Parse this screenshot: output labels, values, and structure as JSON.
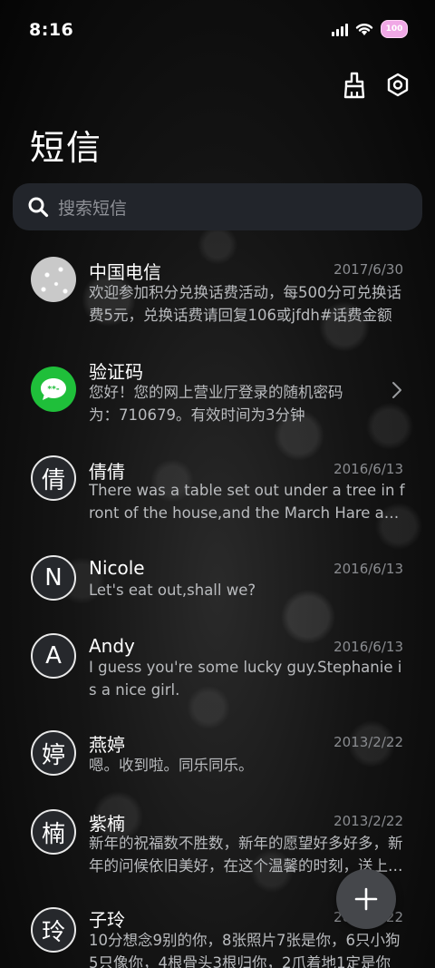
{
  "status_bar": {
    "time": "8:16",
    "battery_level": "100"
  },
  "header": {
    "title": "短信",
    "icons": [
      "brush-icon",
      "settings-icon"
    ]
  },
  "search": {
    "placeholder": "搜索短信"
  },
  "conversations": [
    {
      "name": "中国电信",
      "date": "2017/6/30",
      "preview": "欢迎参加积分兑换话费活动，每500分可兑换话费5元，兑换话费请回复106或jfdh#话费金额"
    },
    {
      "name": "验证码",
      "date": "",
      "preview": "您好！您的网上营业厅登录的随机密码为：710679。有效时间为3分钟"
    },
    {
      "name": "倩倩",
      "avatar": "倩",
      "date": "2016/6/13",
      "preview": "There was a table set out under a tree in front of the house,and the March Hare and the Hatter were having tea"
    },
    {
      "name": "Nicole",
      "avatar": "N",
      "date": "2016/6/13",
      "preview": "Let's eat out,shall we?"
    },
    {
      "name": "Andy",
      "avatar": "A",
      "date": "2016/6/13",
      "preview": "I guess you're some lucky guy.Stephanie is a nice girl."
    },
    {
      "name": "燕婷",
      "avatar": "婷",
      "date": "2013/2/22",
      "preview": "嗯。收到啦。同乐同乐。"
    },
    {
      "name": "紫楠",
      "avatar": "楠",
      "date": "2013/2/22",
      "preview": "新年的祝福数不胜数，新年的愿望好多好多，新年的问候依旧美好，在这个温馨的时刻，送上我的祝福"
    },
    {
      "name": "子玲",
      "avatar": "玲",
      "date": "2013/2/22",
      "preview": "10分想念9别的你，8张照片7张是你，6只小狗5只像你，4根骨头3根归你，2爪着地1定是你"
    }
  ],
  "colors": {
    "background": "#000000",
    "search_bg": "#22252b",
    "fab_bg": "#45474b",
    "green_avatar": "#1fbf3a"
  }
}
